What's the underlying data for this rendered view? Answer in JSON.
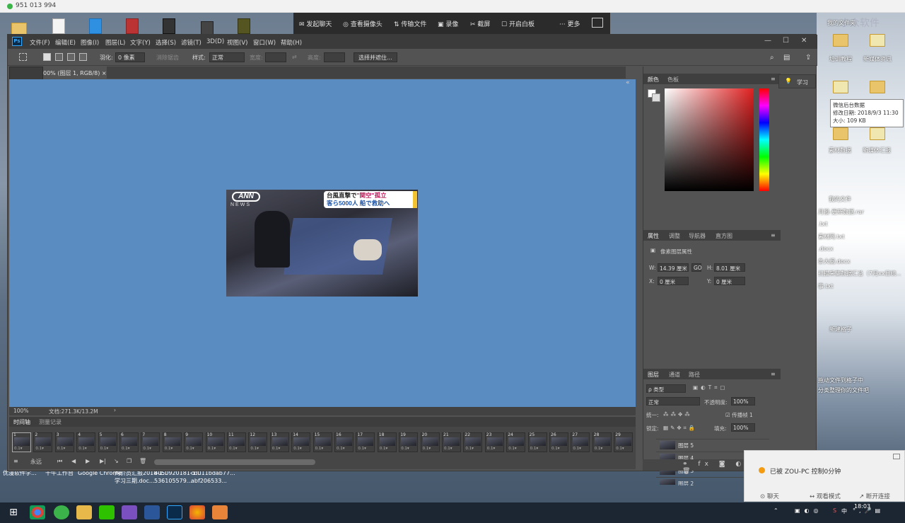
{
  "remote": {
    "id": "951 013 994"
  },
  "remote_toolbar": {
    "items": [
      "发起聊天",
      "查看摄像头",
      "传输文件",
      "录像",
      "截屏",
      "开启白板",
      "更多"
    ]
  },
  "desktop": {
    "top_icons": [
      "",
      "",
      "",
      "",
      "",
      ""
    ],
    "right_icons": [
      "我的文件夹",
      "培训教程",
      "新媒体资讯",
      "素材数据",
      "新媒体汇报"
    ],
    "right_texts": [
      "我的文件",
      "月报-更新数据.rar",
      ".txt",
      "素材网.txt",
      ".docx",
      "条大纲.docx",
      "扫描采集数据汇总（7月xx日统...",
      "事.txt",
      "新建格子",
      "拖动文件到格子中",
      "分类整理你的文件吧"
    ],
    "watermark": "小众软件",
    "bottom_labels": [
      "优漫软件学...",
      "千牛工作台",
      "Google Chrome",
      "同价员汇报2018-1...",
      "4050920181-1...",
      "cd011bdab77...",
      "学习三期.doc...",
      "536105579...",
      "abf206533..."
    ]
  },
  "tooltip": {
    "line1": "微信后台数据",
    "line2": "修改日期: 2018/9/3 11:30",
    "line3": "大小: 109 KB"
  },
  "ps": {
    "menu": [
      "文件(F)",
      "编辑(E)",
      "图像(I)",
      "图层(L)",
      "文字(Y)",
      "选择(S)",
      "滤镜(T)",
      "3D(D)",
      "视图(V)",
      "窗口(W)",
      "帮助(H)"
    ],
    "options": {
      "feather_label": "羽化:",
      "feather_value": "0 像素",
      "antialias": "消除锯齿",
      "style_label": "样式:",
      "style_value": "正常",
      "width_label": "宽度:",
      "height_label": "高度:",
      "select_mask": "选择并遮住..."
    },
    "doc_tab": "00% (图层 1, RGB/8)",
    "status": {
      "zoom": "100%",
      "doc": "文档:271.3K/13.2M"
    },
    "image": {
      "logo": "ANN",
      "news": "NEWS",
      "caption_line1_a": "台風直撃で",
      "caption_line1_b": "\"関空\"孤立",
      "caption_line2": "客ら5000人 船で救助へ"
    },
    "timeline": {
      "tabs": [
        "时间轴",
        "测量记录"
      ],
      "frames": [
        "1",
        "2",
        "3",
        "4",
        "5",
        "6",
        "7",
        "8",
        "9",
        "10",
        "11",
        "12",
        "13",
        "14",
        "15",
        "16",
        "17",
        "18",
        "19",
        "20",
        "21",
        "22",
        "23",
        "24",
        "25",
        "26",
        "27",
        "28",
        "29"
      ],
      "delay": "0.1▾",
      "loop": "永远"
    },
    "color_panel": {
      "tabs": [
        "颜色",
        "色板"
      ]
    },
    "props_panel": {
      "tabs": [
        "属性",
        "调整",
        "导航器",
        "直方图"
      ],
      "title": "像素图层属性",
      "w_label": "W:",
      "w_value": "14.39 厘米",
      "link": "GO",
      "h_label": "H:",
      "h_value": "8.01 厘米",
      "x_label": "X:",
      "x_value": "0 厘米",
      "y_label": "Y:",
      "y_value": "0 厘米"
    },
    "layers_panel": {
      "tabs": [
        "图层",
        "通道",
        "路径"
      ],
      "kind": "ρ 类型",
      "blend": "正常",
      "opacity_label": "不透明度:",
      "opacity_value": "100%",
      "unify_label": "统一:",
      "propagate_label": "传播帧 1",
      "lock_label": "锁定:",
      "fill_label": "填充:",
      "fill_value": "100%",
      "layers": [
        "图层 5",
        "图层 4",
        "图层 3",
        "图层 2"
      ]
    },
    "learn_button": "学习"
  },
  "notification": {
    "message": "已被 ZOU-PC 控制0分钟",
    "buttons": [
      "聊天",
      "观看模式",
      "断开连接"
    ]
  },
  "taskbar": {
    "time": "18:03",
    "ime": "中"
  }
}
